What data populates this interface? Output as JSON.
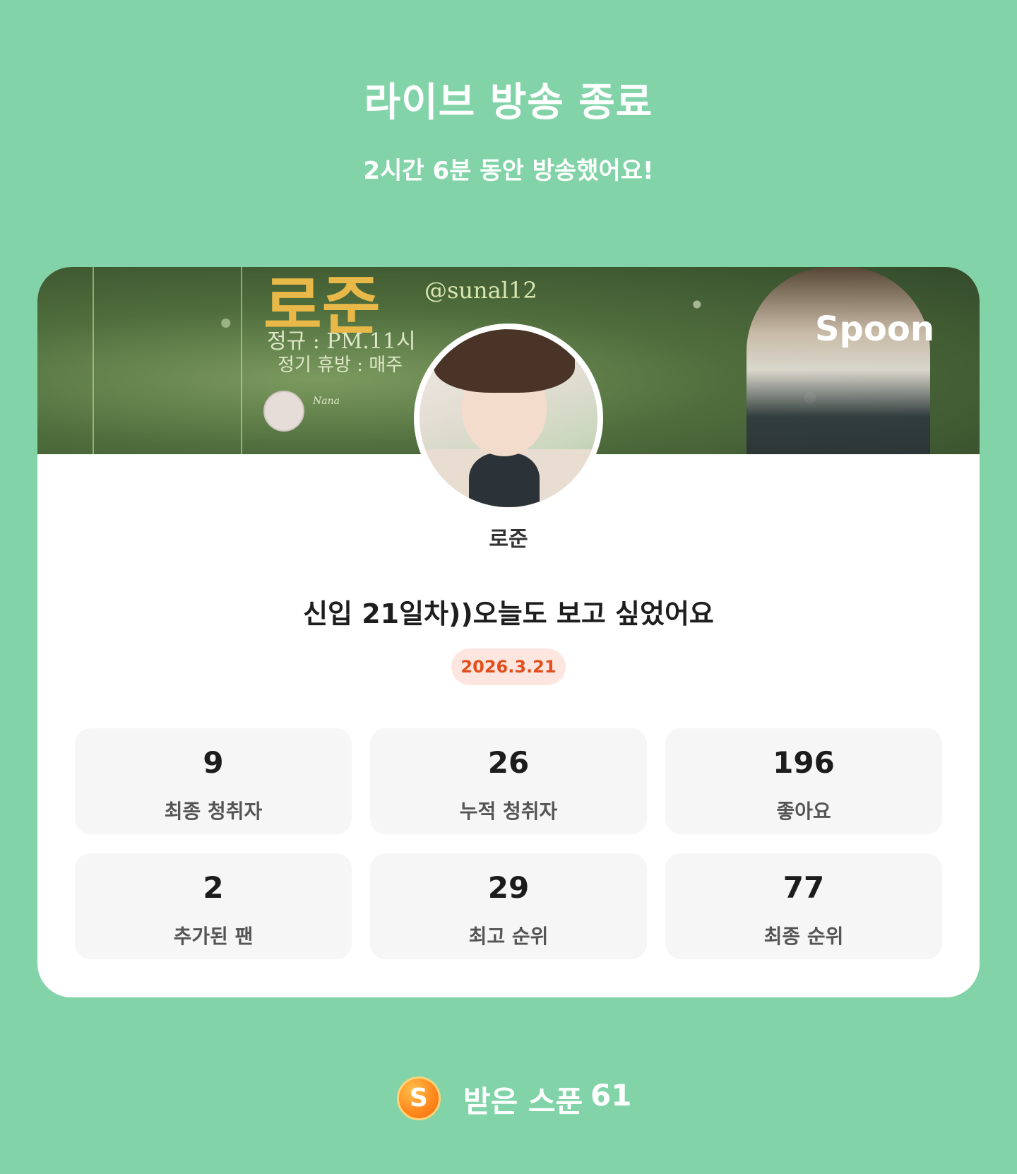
{
  "header": {
    "title": "라이브 방송 종료",
    "subtitle": "2시간 6분 동안 방송했어요!"
  },
  "banner": {
    "name_art": "로준",
    "handle": "@sunal12",
    "schedule_line": "정규 : PM.11시",
    "rest_line": "정기 휴방 : 매주",
    "mini_name": "Nana",
    "brand": "Spoon"
  },
  "profile": {
    "username": "로준"
  },
  "broadcast": {
    "title": "신입 21일차))오늘도 보고 싶었어요",
    "date": "2026.3.21"
  },
  "stats": [
    {
      "value": "9",
      "label": "최종 청취자"
    },
    {
      "value": "26",
      "label": "누적 청취자"
    },
    {
      "value": "196",
      "label": "좋아요"
    },
    {
      "value": "2",
      "label": "추가된 팬"
    },
    {
      "value": "29",
      "label": "최고 순위"
    },
    {
      "value": "77",
      "label": "최종 순위"
    }
  ],
  "spoon": {
    "coin_letter": "S",
    "label": "받은 스푼",
    "count": "61"
  },
  "colors": {
    "background": "#82d4a8",
    "accent": "#e24e1b",
    "badge_bg": "#fde6df"
  }
}
